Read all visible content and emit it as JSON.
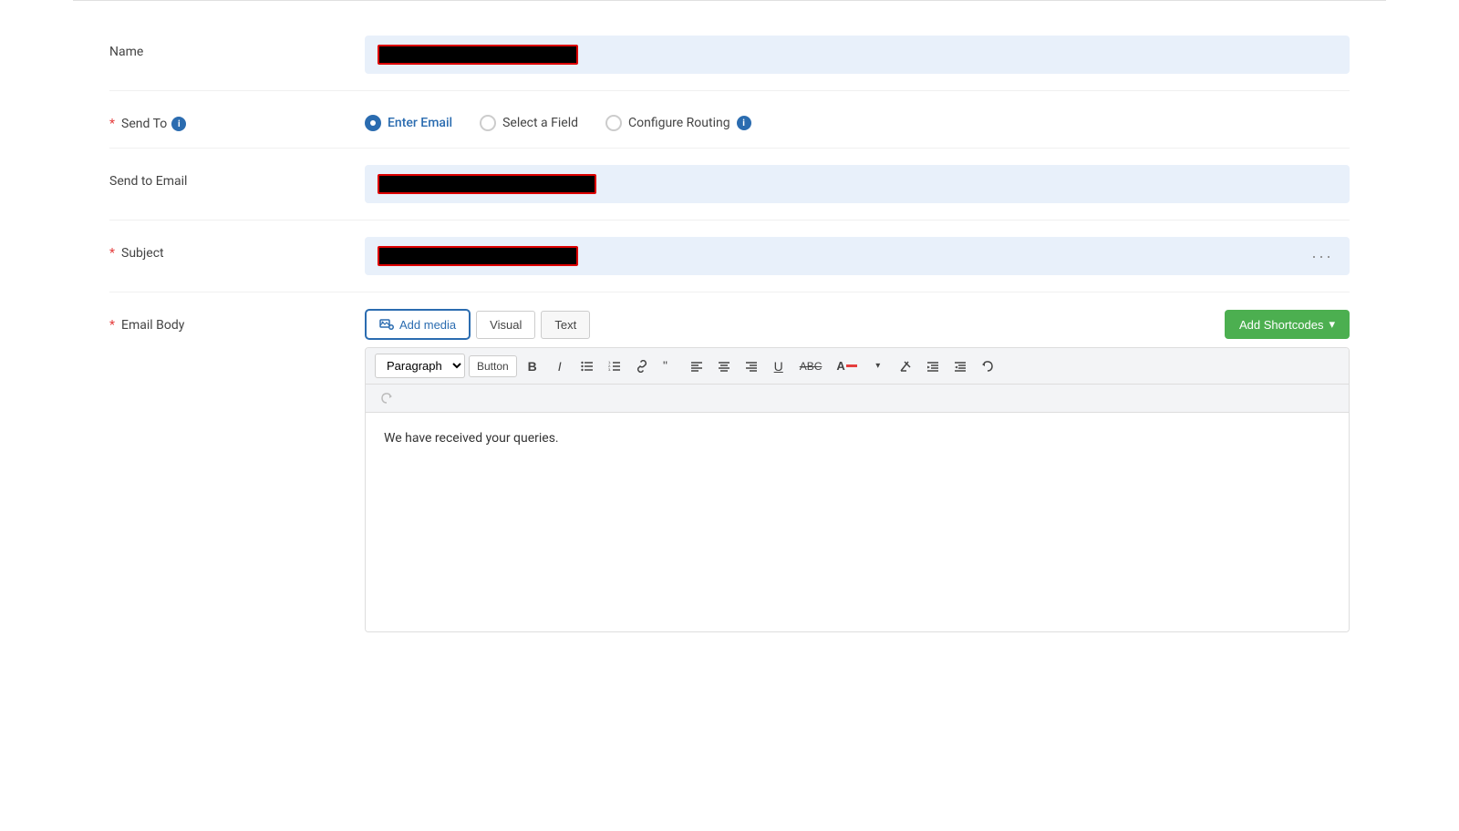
{
  "form": {
    "name_label": "Name",
    "send_to_label": "Send To",
    "send_to_email_label": "Send to Email",
    "subject_label": "Subject",
    "email_body_label": "Email Body"
  },
  "send_to_options": {
    "enter_email": "Enter Email",
    "select_field": "Select a Field",
    "configure_routing": "Configure Routing"
  },
  "toolbar": {
    "add_media": "Add media",
    "visual_tab": "Visual",
    "text_tab": "Text",
    "add_shortcodes": "Add Shortcodes",
    "paragraph_select": "Paragraph",
    "button_label": "Button"
  },
  "editor": {
    "body_text": "We have received your queries."
  },
  "icons": {
    "info": "i",
    "chevron_down": "▾",
    "ellipsis": "···"
  }
}
